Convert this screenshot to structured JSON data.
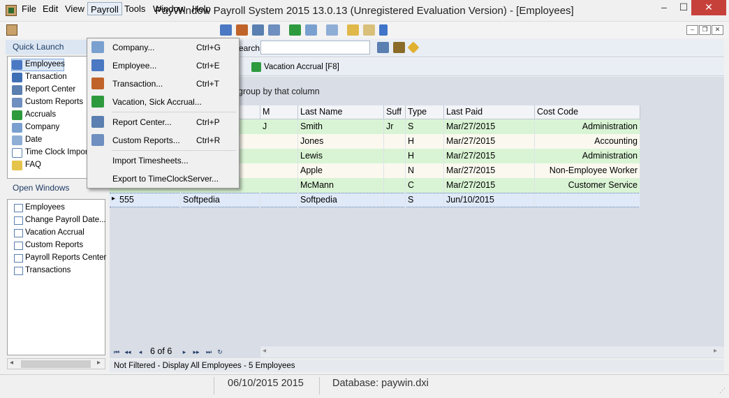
{
  "window": {
    "title": "PayWindow Payroll System 2015  13.0.13 (Unregistered Evaluation Version) - [Employees]",
    "min_glyph": "–",
    "max_glyph": "☐",
    "close_glyph": "✕"
  },
  "menubar": {
    "items": [
      "File",
      "Edit",
      "View",
      "Payroll",
      "Tools",
      "Window",
      "Help"
    ],
    "active": "Payroll",
    "mdi_buttons": [
      "–",
      "❐",
      "✕"
    ]
  },
  "toolbar": {
    "search_label": "earch",
    "search_value": "",
    "vacation_tab": "Vacation Accrual [F8]",
    "tab_fragment": "]"
  },
  "quick_launch": {
    "title": "Quick Launch",
    "selected": "Employees",
    "items": [
      {
        "label": "Employees",
        "icon": "employee-icon"
      },
      {
        "label": "Transaction",
        "icon": "transaction-icon"
      },
      {
        "label": "Report Center",
        "icon": "report-center-icon"
      },
      {
        "label": "Custom Reports",
        "icon": "custom-reports-icon"
      },
      {
        "label": "Accruals",
        "icon": "accruals-icon"
      },
      {
        "label": "Company",
        "icon": "company-icon"
      },
      {
        "label": "Date",
        "icon": "date-icon"
      },
      {
        "label": "Time Clock Import",
        "icon": "time-clock-icon"
      },
      {
        "label": "FAQ",
        "icon": "faq-icon"
      }
    ]
  },
  "open_windows": {
    "title": "Open Windows",
    "items": [
      "Employees",
      "Change Payroll Date...",
      "Vacation Accrual",
      "Custom Reports",
      "Payroll Reports Center",
      "Transactions"
    ]
  },
  "grid": {
    "group_hint": "group by that column",
    "columns": [
      "M",
      "Last Name",
      "Suff",
      "Type",
      "Last Paid",
      "Cost Code"
    ],
    "rows": [
      {
        "id": "",
        "first": "",
        "m": "J",
        "last": "Smith",
        "suff": "Jr",
        "type": "S",
        "paid": "Mar/27/2015",
        "cost": "Administration"
      },
      {
        "id": "",
        "first": "",
        "m": "",
        "last": "Jones",
        "suff": "",
        "type": "H",
        "paid": "Mar/27/2015",
        "cost": "Accounting"
      },
      {
        "id": "",
        "first": "",
        "m": "",
        "last": "Lewis",
        "suff": "",
        "type": "H",
        "paid": "Mar/27/2015",
        "cost": "Administration"
      },
      {
        "id": "",
        "first": "",
        "m": "",
        "last": "Apple",
        "suff": "",
        "type": "N",
        "paid": "Mar/27/2015",
        "cost": "Non-Employee Worker"
      },
      {
        "id": "",
        "first": "",
        "m": "",
        "last": "McMann",
        "suff": "",
        "type": "C",
        "paid": "Mar/27/2015",
        "cost": "Customer Service"
      },
      {
        "id": "555",
        "first": "Softpedia",
        "m": "",
        "last": "Softpedia",
        "suff": "",
        "type": "S",
        "paid": "Jun/10/2015",
        "cost": ""
      }
    ],
    "row_indicator": "▸"
  },
  "pager": {
    "label": "6 of 6",
    "first": "⏮",
    "prev_page": "◂◂",
    "prev": "◂",
    "next": "▸",
    "next_page": "▸▸",
    "last": "⏭",
    "refresh": "↻",
    "scroll_left": "◂",
    "scroll_right": "▸"
  },
  "filter_status": "Not Filtered - Display All Employees  - 5 Employees",
  "statusbar": {
    "date": "06/10/2015 2015",
    "database": "Database: paywin.dxi"
  },
  "payroll_menu": {
    "items": [
      {
        "label": "Company...",
        "accel": "Ctrl+G",
        "icon": "company-icon"
      },
      {
        "label": "Employee...",
        "accel": "Ctrl+E",
        "icon": "employee-icon"
      },
      {
        "label": "Transaction...",
        "accel": "Ctrl+T",
        "icon": "transaction-icon"
      },
      {
        "label": "Vacation, Sick Accrual...",
        "accel": "",
        "icon": "accrual-icon"
      },
      {
        "label": "Report Center...",
        "accel": "Ctrl+P",
        "icon": "report-center-icon"
      },
      {
        "label": "Custom Reports...",
        "accel": "Ctrl+R",
        "icon": "custom-reports-icon"
      },
      {
        "label": "Import Timesheets...",
        "accel": "",
        "icon": ""
      },
      {
        "label": "Export to TimeClockServer...",
        "accel": "",
        "icon": ""
      }
    ]
  }
}
